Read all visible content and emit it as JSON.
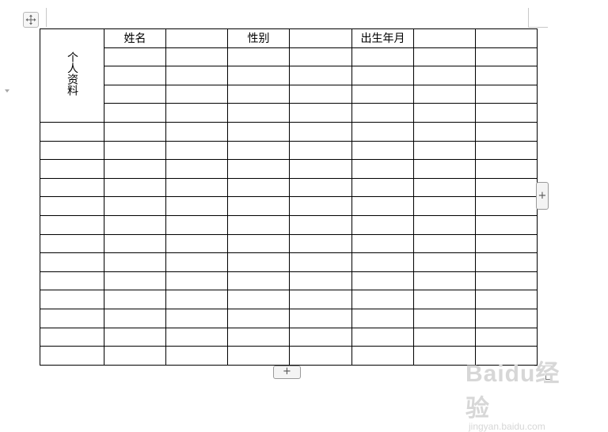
{
  "table": {
    "vertical_label": "个人资料",
    "name_label": "姓名",
    "gender_label": "性别",
    "birth_label": "出生年月",
    "extra_rows": 13
  },
  "controls": {
    "add_row_label": "+",
    "add_column_label": "+"
  },
  "watermark": {
    "brand": "Baidu经验",
    "url": "jingyan.baidu.com"
  }
}
